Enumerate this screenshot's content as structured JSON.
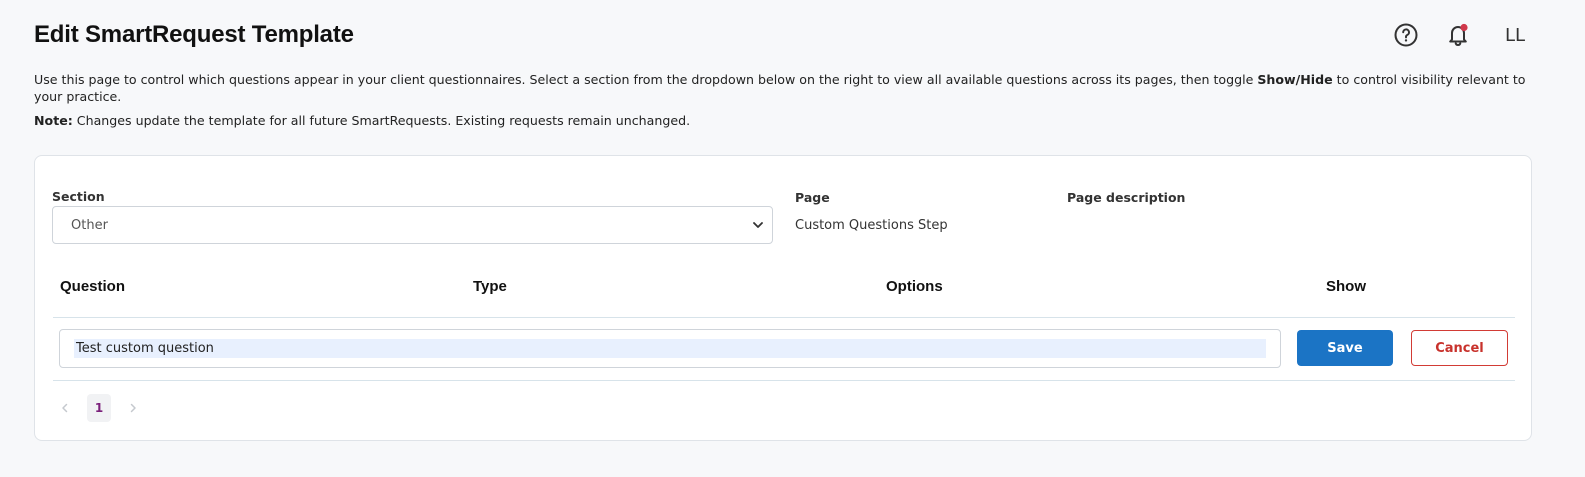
{
  "header": {
    "title": "Edit SmartRequest Template",
    "help_icon": "question-circle-icon",
    "notification_icon": "bell-icon",
    "notification_dot_color": "#d0384b",
    "avatar_initials": "LL"
  },
  "intro": {
    "text_before": "Use this page to control which questions appear in your client questionnaires. Select a section from the dropdown below on the right to view all available questions across its pages, then toggle ",
    "text_bold": "Show/Hide",
    "text_after": " to control visibility relevant to your practice.",
    "note_label": "Note:",
    "note_text": " Changes update the template for all future SmartRequests. Existing requests remain unchanged."
  },
  "filters": {
    "section_label": "Section",
    "section_value": "Other",
    "page_label": "Page",
    "page_value": "Custom Questions Step",
    "page_description_label": "Page description",
    "page_description_value": ""
  },
  "table": {
    "columns": [
      "Question",
      "Type",
      "Options",
      "Show"
    ],
    "edit_row": {
      "question_value": "Test custom question",
      "save_label": "Save",
      "cancel_label": "Cancel"
    }
  },
  "pagination": {
    "current_page": "1",
    "prev_icon": "chevron-left-icon",
    "next_icon": "chevron-right-icon"
  },
  "colors": {
    "primary": "#1b74c5",
    "danger": "#d23b35",
    "page_active": "#7a1f7a",
    "background": "#f7f8fa"
  }
}
